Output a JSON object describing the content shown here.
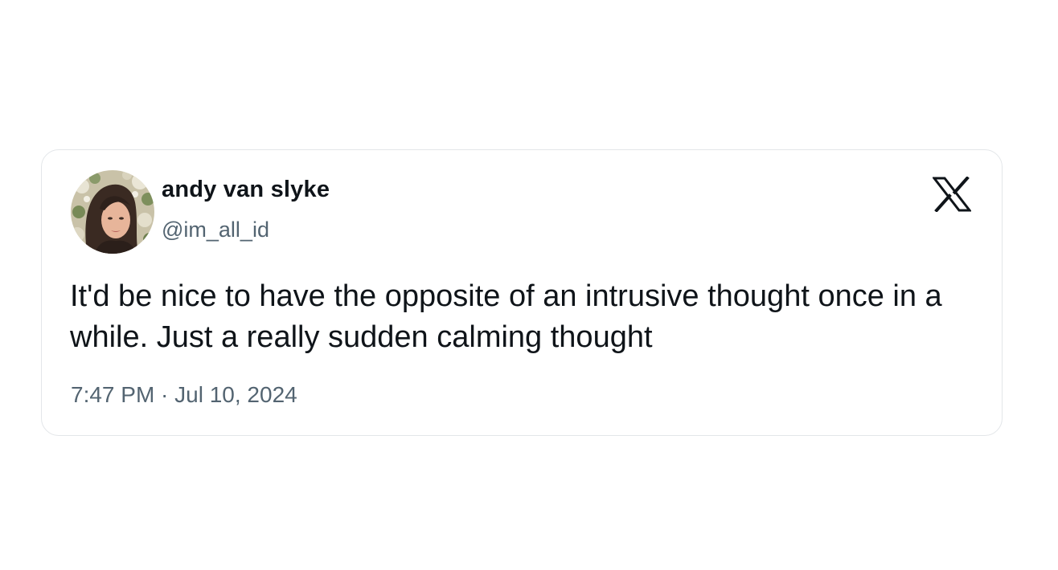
{
  "tweet": {
    "display_name": "andy van slyke",
    "handle": "@im_all_id",
    "text": "It'd be nice to have the opposite of an intrusive thought once in a while. Just a really sudden calming thought",
    "timestamp": "7:47 PM · Jul 10, 2024",
    "brand_icon": "x-logo-icon",
    "avatar_icon": "profile-photo"
  },
  "colors": {
    "text_primary": "#0f1419",
    "text_secondary": "#536471",
    "card_border": "#e3e6e9",
    "background": "#ffffff"
  }
}
